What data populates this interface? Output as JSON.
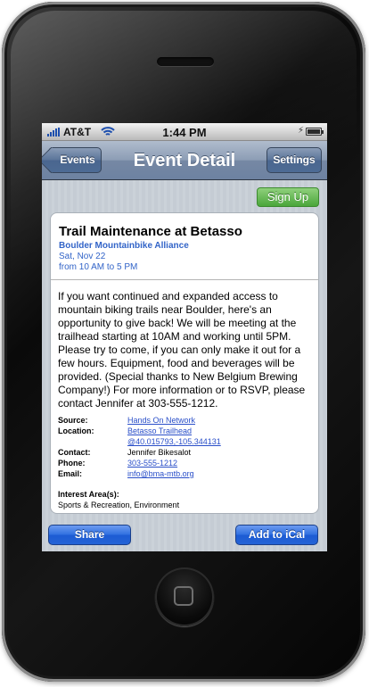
{
  "status_bar": {
    "carrier": "AT&T",
    "time": "1:44 PM",
    "icons": [
      "signal-bars-icon",
      "wifi-icon",
      "charging-bolt-icon",
      "battery-icon"
    ]
  },
  "nav": {
    "back_label": "Events",
    "title": "Event Detail",
    "settings_label": "Settings"
  },
  "signup_label": "Sign Up",
  "event": {
    "title": "Trail Maintenance at Betasso",
    "organization": "Boulder Mountainbike Alliance",
    "date": "Sat, Nov 22",
    "time": "from 10 AM to 5 PM",
    "description": "If you want continued and expanded access to mountain biking trails near Boulder, here's an opportunity to give back! We will be meeting at the trailhead starting at 10AM and working until 5PM. Please try to come, if you can only make it out for a few hours. Equipment, food and beverages will be provided. (Special thanks to New Belgium Brewing Company!) For more information or to RSVP, please contact Jennifer at 303-555-1212."
  },
  "details": {
    "source_label": "Source:",
    "source_value": "Hands On Network",
    "location_label": "Location:",
    "location_value": "Betasso Trailhead",
    "coordinates": "@40.015793,-105.344131",
    "contact_label": "Contact:",
    "contact_value": "Jennifer Bikesalot",
    "phone_label": "Phone:",
    "phone_value": "303-555-1212",
    "email_label": "Email:",
    "email_value": "info@bma-mtb.org"
  },
  "interest": {
    "label": "Interest Area(s):",
    "value": "Sports & Recreation, Environment"
  },
  "bottom": {
    "share_label": "Share",
    "ical_label": "Add to iCal"
  },
  "colors": {
    "nav_bar": "#6d82a1",
    "link_blue": "#2a4fc9",
    "org_blue": "#3264c8",
    "signup_green": "#4aa63a",
    "button_blue": "#2463d6"
  }
}
